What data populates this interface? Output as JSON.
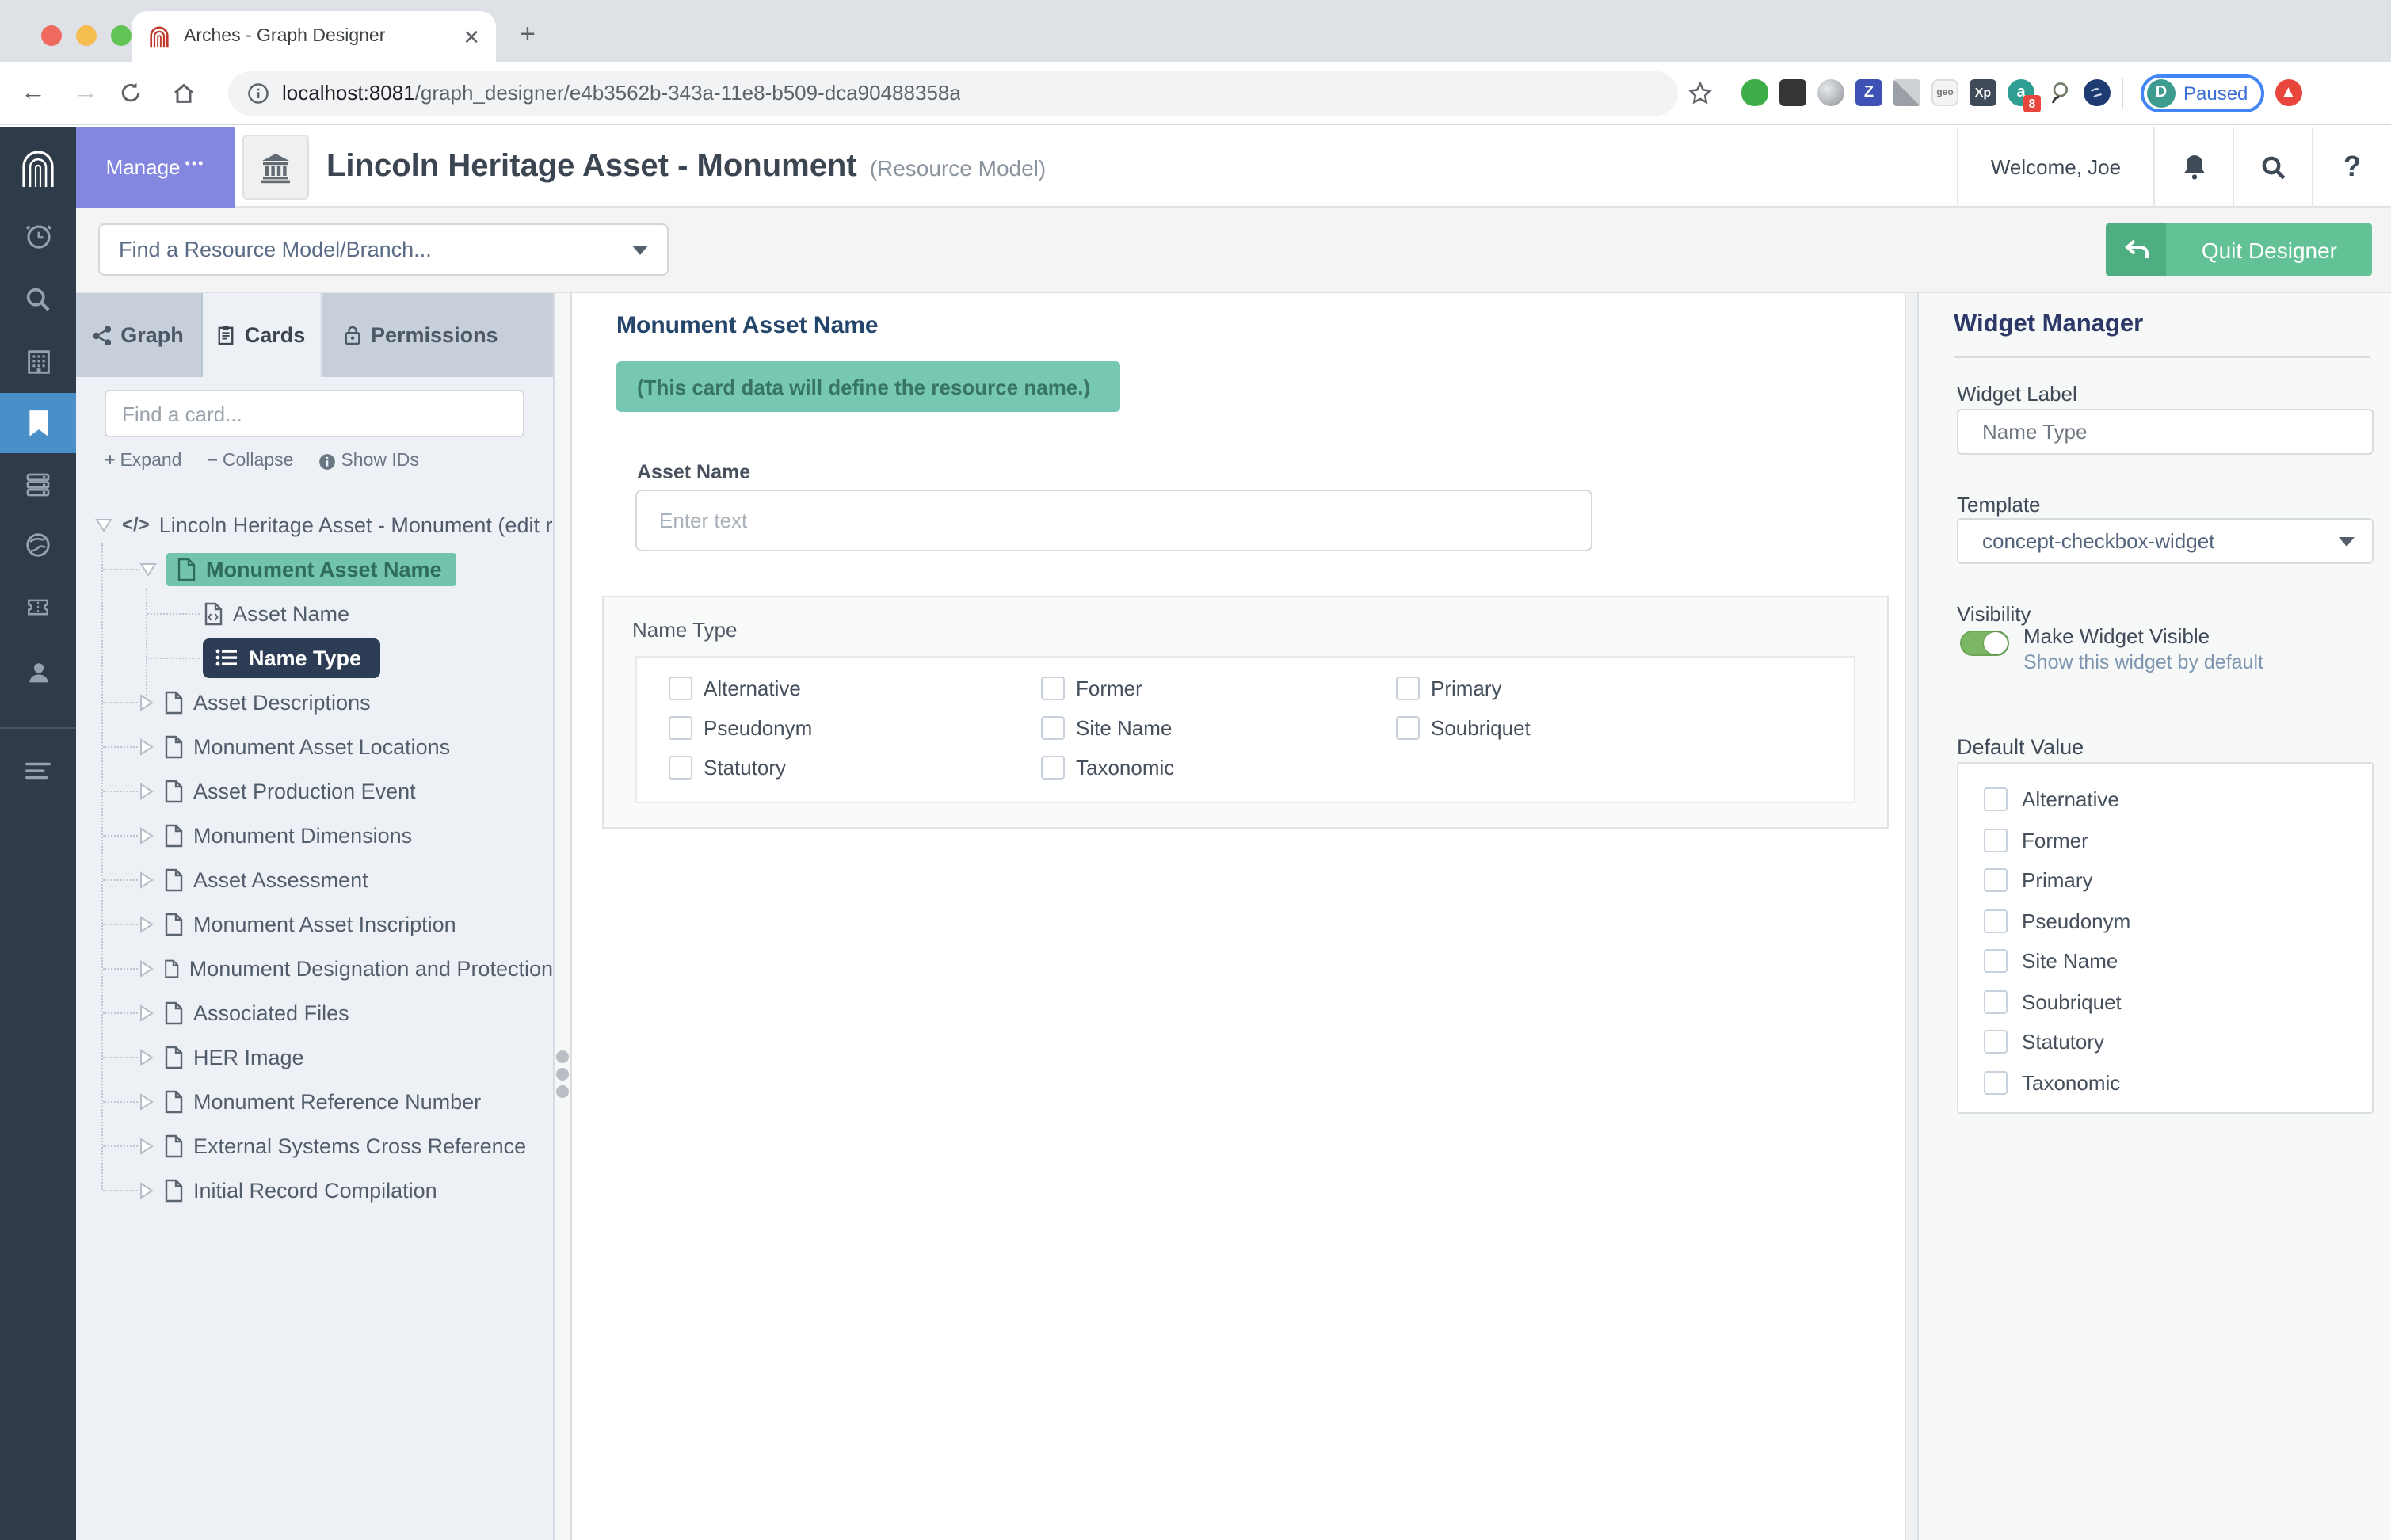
{
  "browser": {
    "tab_title": "Arches - Graph Designer",
    "url_host": "localhost:8081",
    "url_path": "/graph_designer/e4b3562b-343a-11e8-b509-dca90488358a",
    "new_tab": "+",
    "close_tab": "✕",
    "profile_initial": "D",
    "profile_status": "Paused",
    "ext_badge_count": "8"
  },
  "header": {
    "manage": "Manage",
    "title": "Lincoln Heritage Asset - Monument",
    "subtitle": "(Resource Model)",
    "welcome": "Welcome, Joe"
  },
  "subheader": {
    "model_dropdown": "Find a Resource Model/Branch...",
    "quit": "Quit Designer"
  },
  "tabs": {
    "graph": "Graph",
    "cards": "Cards",
    "permissions": "Permissions"
  },
  "cards_panel": {
    "search_placeholder": "Find a card...",
    "expand": "Expand",
    "collapse": "Collapse",
    "show_ids": "Show IDs"
  },
  "tree": {
    "items": [
      "Lincoln Heritage Asset - Monument (edit r",
      "Monument Asset Name",
      "Asset Name",
      "Name Type",
      "Asset Descriptions",
      "Monument Asset Locations",
      "Asset Production Event",
      "Monument Dimensions",
      "Asset Assessment",
      "Monument Asset Inscription",
      "Monument Designation and Protection",
      "Associated Files",
      "HER Image",
      "Monument Reference Number",
      "External Systems Cross Reference",
      "Initial Record Compilation"
    ]
  },
  "main": {
    "card_title": "Monument Asset Name",
    "note": "(This card data will define the resource name.)",
    "asset_name_label": "Asset Name",
    "asset_name_placeholder": "Enter text",
    "name_type_label": "Name Type",
    "options": [
      "Alternative",
      "Former",
      "Primary",
      "Pseudonym",
      "Site Name",
      "Soubriquet",
      "Statutory",
      "Taxonomic"
    ]
  },
  "widget": {
    "title": "Widget Manager",
    "widget_label": "Widget Label",
    "widget_label_value": "Name Type",
    "template_label": "Template",
    "template_value": "concept-checkbox-widget",
    "visibility_label": "Visibility",
    "visible_label": "Make Widget Visible",
    "visible_sub": "Show this widget by default",
    "default_value_label": "Default Value",
    "options": [
      "Alternative",
      "Former",
      "Primary",
      "Pseudonym",
      "Site Name",
      "Soubriquet",
      "Statutory",
      "Taxonomic"
    ]
  },
  "colors": {
    "accent_purple": "#8487e0",
    "sidebar_navy": "#2f3b49",
    "sidebar_active_blue": "#4a90c8",
    "teal_highlight": "#72c4ad",
    "teal_note": "#77c8b3",
    "selected_navy": "#2d3c55",
    "quit_green": "#62c295",
    "toggle_green": "#7cb765",
    "favicon_red": "#c0392b",
    "profile_ring_blue": "#4285f4",
    "badge_red": "#e8453c"
  }
}
